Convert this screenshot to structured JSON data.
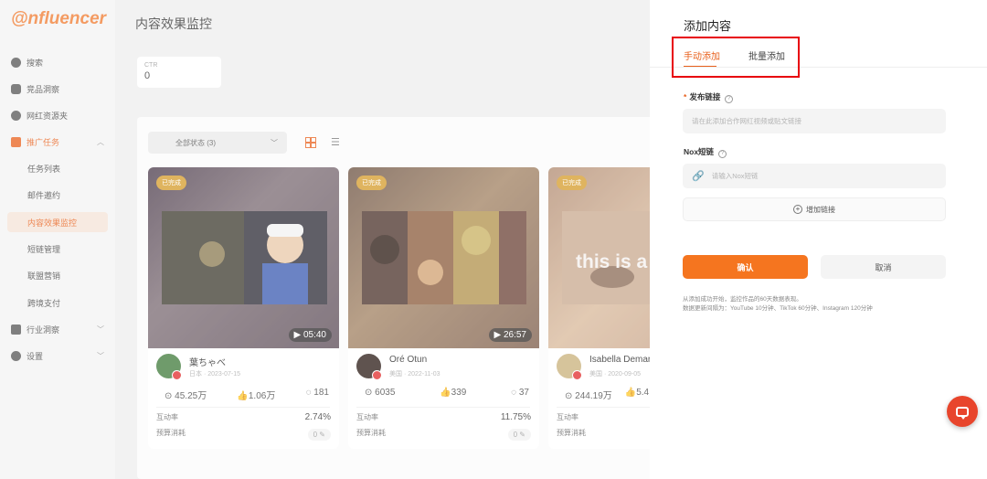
{
  "app": {
    "logo": "nfluencer",
    "page_title": "内容效果监控"
  },
  "sidebar": {
    "items": [
      {
        "label": "搜索",
        "icon": "compass-icon"
      },
      {
        "label": "竞品洞察",
        "icon": "r-badge-icon"
      },
      {
        "label": "网红资源夹",
        "icon": "heart-icon"
      },
      {
        "label": "推广任务",
        "icon": "task-icon"
      },
      {
        "label": "任务列表"
      },
      {
        "label": "邮件邀约"
      },
      {
        "label": "内容效果监控"
      },
      {
        "label": "短链管理"
      },
      {
        "label": "联盟营销"
      },
      {
        "label": "跨境支付"
      },
      {
        "label": "行业洞察",
        "icon": "chart-icon"
      },
      {
        "label": "设置",
        "icon": "gear-icon"
      }
    ]
  },
  "ctr": {
    "label": "CTR",
    "value": "0"
  },
  "filter": {
    "status": "全部状态 (3)"
  },
  "cards": [
    {
      "status": "已完成",
      "duration": "05:40",
      "name": "葉ちゃべ",
      "meta": "日本 · 2023-07-15",
      "views": "45.25万",
      "likes": "1.06万",
      "comments": "181",
      "rate_label": "互动率",
      "rate": "2.74%",
      "budget_label": "预算消耗",
      "budget": "0"
    },
    {
      "status": "已完成",
      "duration": "26:57",
      "name": "Oré Otun",
      "meta": "美国 · 2022-11-03",
      "views": "6035",
      "likes": "339",
      "comments": "37",
      "rate_label": "互动率",
      "rate": "11.75%",
      "budget_label": "预算消耗",
      "budget": "0"
    },
    {
      "status": "已完成",
      "duration": "",
      "name": "Isabella Demar",
      "meta": "美国 · 2020-09-05",
      "views": "244.19万",
      "likes": "5.4",
      "comments": "",
      "rate_label": "互动率",
      "rate": "",
      "budget_label": "预算消耗",
      "budget": "",
      "thumb_text": "this is a"
    }
  ],
  "drawer": {
    "title": "添加内容",
    "tabs": [
      "手动添加",
      "批量添加"
    ],
    "publish_link_label": "发布链接",
    "publish_link_placeholder": "请在此添加合作网红视频或贴文链接",
    "nox_label": "Nox短链",
    "nox_placeholder": "请输入Nox短链",
    "add_link": "增加链接",
    "confirm": "确认",
    "cancel": "取消",
    "note1": "从添加成功开始，监控作品的60天数据表现。",
    "note2": "数据更新间隔为：YouTube 10分钟、TikTok 60分钟、Instagram 120分钟"
  },
  "colors": {
    "accent": "#f5751f",
    "highlight": "#e8000b"
  }
}
